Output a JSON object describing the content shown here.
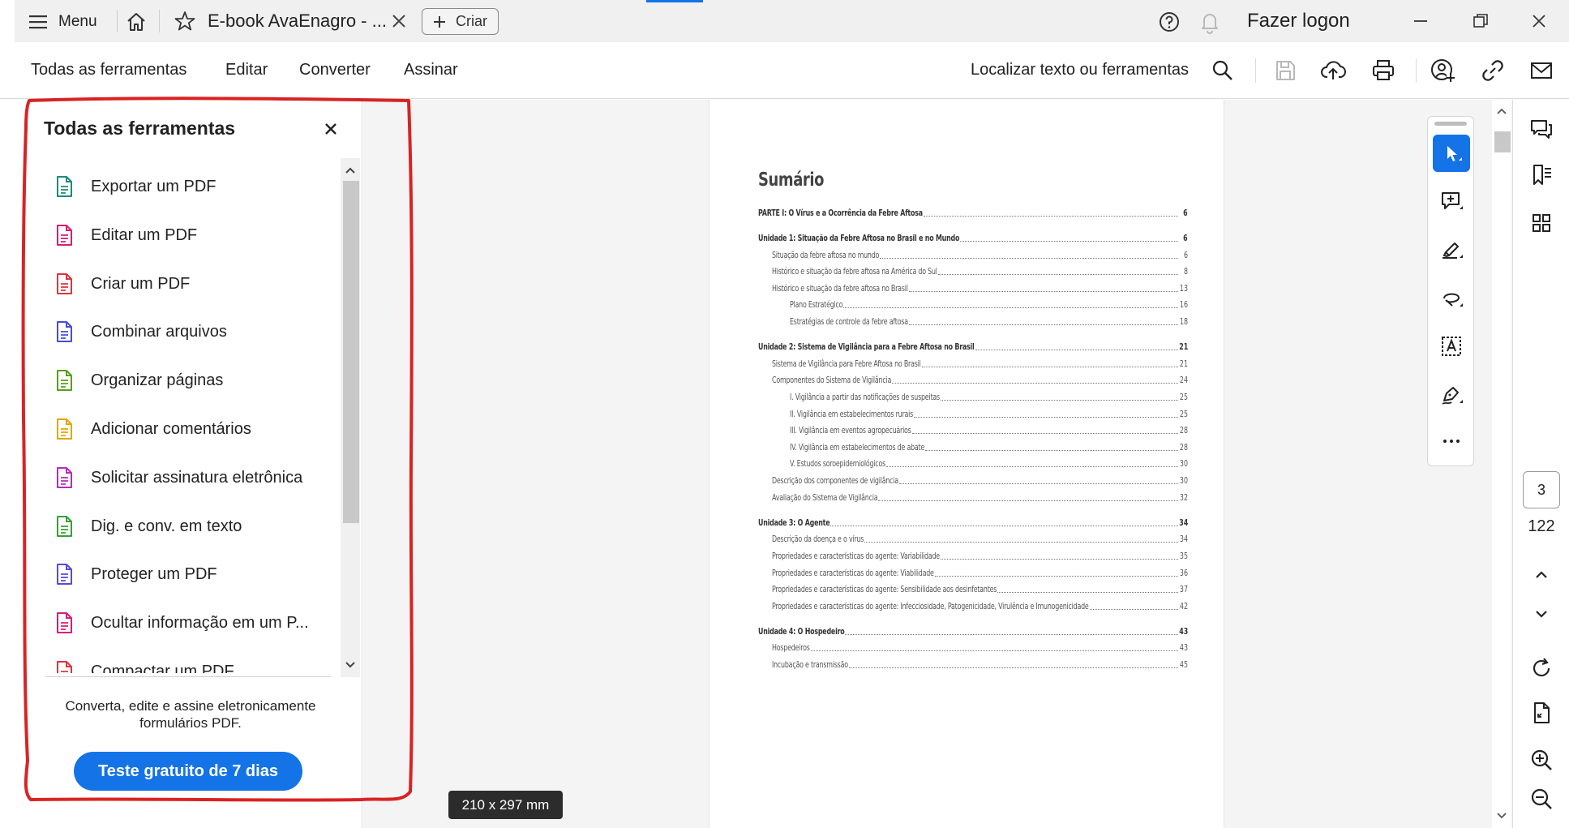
{
  "titlebar": {
    "menu_label": "Menu",
    "tab_title": "E-book AvaEnagro - ...",
    "create_label": "Criar",
    "logon_label": "Fazer logon"
  },
  "toolbar": {
    "menus": [
      "Todas as ferramentas",
      "Editar",
      "Converter",
      "Assinar"
    ],
    "find_label": "Localizar texto ou ferramentas"
  },
  "panel": {
    "title": "Todas as ferramentas",
    "items": [
      {
        "label": "Exportar um PDF",
        "icon": "export-pdf-icon",
        "color": "#1e8a7c"
      },
      {
        "label": "Editar um PDF",
        "icon": "edit-pdf-icon",
        "color": "#d61f73"
      },
      {
        "label": "Criar um PDF",
        "icon": "create-pdf-icon",
        "color": "#d7373f"
      },
      {
        "label": "Combinar arquivos",
        "icon": "combine-files-icon",
        "color": "#4b4bd6"
      },
      {
        "label": "Organizar páginas",
        "icon": "organize-pages-icon",
        "color": "#5a9e1e"
      },
      {
        "label": "Adicionar comentários",
        "icon": "add-comments-icon",
        "color": "#e0a800"
      },
      {
        "label": "Solicitar assinatura eletrônica",
        "icon": "request-esign-icon",
        "color": "#b22fb8"
      },
      {
        "label": "Dig. e conv. em texto",
        "icon": "scan-ocr-icon",
        "color": "#3a9e3a"
      },
      {
        "label": "Proteger um PDF",
        "icon": "protect-pdf-icon",
        "color": "#5a4bd6"
      },
      {
        "label": "Ocultar informação em um P...",
        "icon": "redact-icon",
        "color": "#d61f73"
      },
      {
        "label": "Compactar um PDF",
        "icon": "compress-pdf-icon",
        "color": "#d7373f"
      }
    ],
    "promo_text": "Converta, edite e assine eletronicamente formulários PDF.",
    "trial_label": "Teste gratuito de 7 dias"
  },
  "document": {
    "toc_title": "Sumário",
    "entries": [
      {
        "text": "PARTE I: O Vírus e a Ocorrência da Febre Aftosa",
        "page": "6",
        "level": 0,
        "bold": true
      },
      {
        "text": "Unidade 1: Situação da Febre Aftosa no Brasil e no Mundo",
        "page": "6",
        "level": 0,
        "bold": true
      },
      {
        "text": "Situação da febre aftosa no mundo",
        "page": "6",
        "level": 1,
        "bold": false
      },
      {
        "text": "Histórico e situação da febre aftosa na América do Sul",
        "page": "8",
        "level": 1,
        "bold": false
      },
      {
        "text": "Histórico e situação da febre aftosa no Brasil",
        "page": "13",
        "level": 1,
        "bold": false
      },
      {
        "text": "Plano Estratégico",
        "page": "16",
        "level": 2,
        "bold": false
      },
      {
        "text": "Estratégias de controle da febre aftosa",
        "page": "18",
        "level": 2,
        "bold": false
      },
      {
        "text": "Unidade 2: Sistema de Vigilância para a Febre Aftosa no Brasil",
        "page": "21",
        "level": 0,
        "bold": true
      },
      {
        "text": "Sistema de Vigilância para Febre Aftosa no Brasil",
        "page": "21",
        "level": 1,
        "bold": false
      },
      {
        "text": "Componentes do Sistema de Vigilância",
        "page": "24",
        "level": 1,
        "bold": false
      },
      {
        "text": "I. Vigilância a partir das notificações de suspeitas",
        "page": "25",
        "level": 2,
        "bold": false
      },
      {
        "text": "II. Vigilância em estabelecimentos rurais",
        "page": "25",
        "level": 2,
        "bold": false
      },
      {
        "text": "III. Vigilância em eventos agropecuários",
        "page": "28",
        "level": 2,
        "bold": false
      },
      {
        "text": "IV. Vigilância em estabelecimentos de abate",
        "page": "28",
        "level": 2,
        "bold": false
      },
      {
        "text": "V. Estudos soroepidemiológicos",
        "page": "30",
        "level": 2,
        "bold": false
      },
      {
        "text": "Descrição dos componentes de vigilância",
        "page": "30",
        "level": 1,
        "bold": false
      },
      {
        "text": "Avaliação do Sistema de Vigilância",
        "page": "32",
        "level": 1,
        "bold": false
      },
      {
        "text": "Unidade 3: O Agente",
        "page": "34",
        "level": 0,
        "bold": true
      },
      {
        "text": "Descrição da doença e o vírus",
        "page": "34",
        "level": 1,
        "bold": false
      },
      {
        "text": "Propriedades e características do agente: Variabilidade",
        "page": "35",
        "level": 1,
        "bold": false
      },
      {
        "text": "Propriedades e características do agente: Viabilidade",
        "page": "36",
        "level": 1,
        "bold": false
      },
      {
        "text": "Propriedades e características do agente: Sensibilidade aos desinfetantes",
        "page": "37",
        "level": 1,
        "bold": false
      },
      {
        "text": "Propriedades e características do agente: Infecciosidade, Patogenicidade, Virulência e Imunogenicidade",
        "page": "42",
        "level": 1,
        "bold": false
      },
      {
        "text": "Unidade 4: O Hospedeiro",
        "page": "43",
        "level": 0,
        "bold": true
      },
      {
        "text": "Hospedeiros",
        "page": "43",
        "level": 1,
        "bold": false
      },
      {
        "text": "Incubação e transmissão",
        "page": "45",
        "level": 1,
        "bold": false
      }
    ],
    "page_size": "210 x 297 mm"
  },
  "navigation": {
    "current_page": "3",
    "total_pages": "122"
  },
  "colors": {
    "accent": "#1473e6",
    "annotation": "#d92323"
  }
}
